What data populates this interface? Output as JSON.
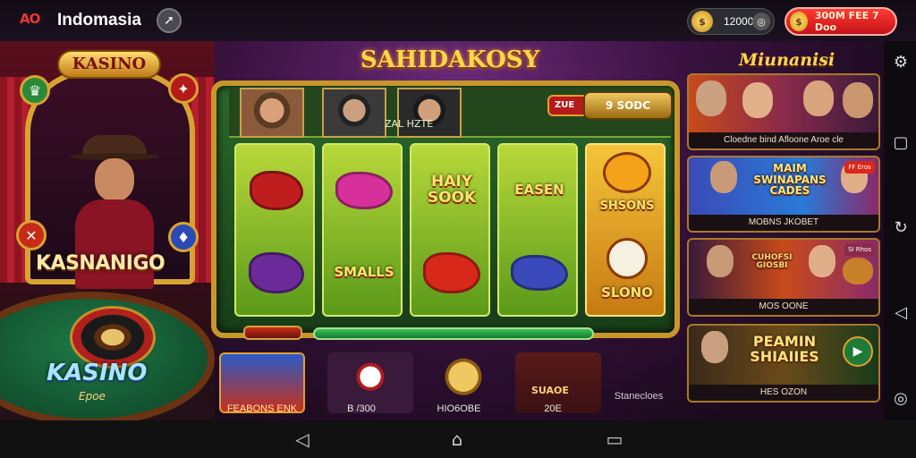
{
  "topbar": {
    "logo": "AO",
    "title": "Indomasia",
    "coins": "12000",
    "coins_icon": "coin-icon",
    "promo": "300M FEE 7 Doo"
  },
  "left_panel": {
    "sign": "KASINO",
    "banner": "KASNANIGO",
    "logo": "KASINO",
    "logo_sub": "Epoe"
  },
  "machine": {
    "title": "SAHIDAKOSY",
    "bet_red": "ZUE",
    "bet_gold": "9 SODC",
    "bet_sub": "ZAL HZTE",
    "reels": [
      {
        "top": "",
        "bottom": ""
      },
      {
        "top": "",
        "bottom": "SMALLS"
      },
      {
        "top": "HAIY SOOK",
        "bottom": ""
      },
      {
        "top": "EASEN",
        "bottom": ""
      },
      {
        "top": "SHSONS",
        "bottom": "SLONO"
      }
    ]
  },
  "shelf": {
    "items": [
      {
        "label": "FEABONS ENK"
      },
      {
        "label": "B /300"
      },
      {
        "label": "HIO6OBE"
      },
      {
        "label": "20E"
      },
      {
        "label": "Stanecloes"
      }
    ],
    "badge": "SUAOE"
  },
  "right_panel": {
    "title": "Miunanisi",
    "cards": [
      {
        "caption": "Cloedne bind Afloone Aroe cle"
      },
      {
        "title": "MAIM SWINAPANS CADES",
        "caption": "MOBNS JKOBET",
        "badge": "FF Eros"
      },
      {
        "title": "CUHOFSI GIOSBI",
        "caption": "MOS OONE",
        "badge": "SI Rhos"
      },
      {
        "title": "PEAMIN SHIAIIES",
        "caption": "HES OZON"
      }
    ]
  },
  "colors": {
    "accent_gold": "#d7a431",
    "reel_green": "#5a9a1a",
    "promo_red": "#c4121a"
  }
}
